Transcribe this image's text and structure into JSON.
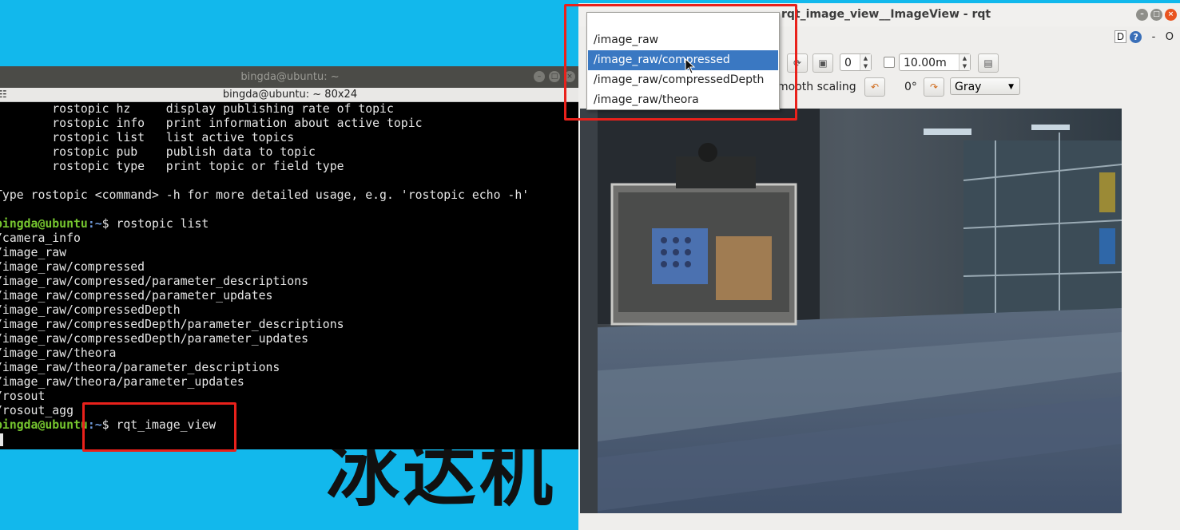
{
  "background": {
    "watermark_text": "冰达机",
    "color": "#12b8ec"
  },
  "terminal": {
    "title": "bingda@ubuntu: ~",
    "subtitle": "bingda@ubuntu: ~ 80x24",
    "lines": [
      {
        "type": "text",
        "text": "        rostopic hz     display publishing rate of topic"
      },
      {
        "type": "text",
        "text": "        rostopic info   print information about active topic"
      },
      {
        "type": "text",
        "text": "        rostopic list   list active topics"
      },
      {
        "type": "text",
        "text": "        rostopic pub    publish data to topic"
      },
      {
        "type": "text",
        "text": "        rostopic type   print topic or field type"
      },
      {
        "type": "text",
        "text": ""
      },
      {
        "type": "text",
        "text": "Type rostopic <command> -h for more detailed usage, e.g. 'rostopic echo -h'"
      },
      {
        "type": "text",
        "text": ""
      },
      {
        "type": "prompt",
        "user": "bingda@ubuntu",
        "path": ":~",
        "cmd": "$ rostopic list"
      },
      {
        "type": "text",
        "text": "/camera_info"
      },
      {
        "type": "text",
        "text": "/image_raw"
      },
      {
        "type": "text",
        "text": "/image_raw/compressed"
      },
      {
        "type": "text",
        "text": "/image_raw/compressed/parameter_descriptions"
      },
      {
        "type": "text",
        "text": "/image_raw/compressed/parameter_updates"
      },
      {
        "type": "text",
        "text": "/image_raw/compressedDepth"
      },
      {
        "type": "text",
        "text": "/image_raw/compressedDepth/parameter_descriptions"
      },
      {
        "type": "text",
        "text": "/image_raw/compressedDepth/parameter_updates"
      },
      {
        "type": "text",
        "text": "/image_raw/theora"
      },
      {
        "type": "text",
        "text": "/image_raw/theora/parameter_descriptions"
      },
      {
        "type": "text",
        "text": "/image_raw/theora/parameter_updates"
      },
      {
        "type": "text",
        "text": "/rosout"
      },
      {
        "type": "text",
        "text": "/rosout_agg"
      },
      {
        "type": "prompt",
        "user": "bingda@ubuntu",
        "path": ":~",
        "cmd": "$ rqt_image_view"
      }
    ],
    "prompt_color_user": "#76c62f",
    "prompt_color_path": "#6d97d6"
  },
  "rqt": {
    "title": "rqt_image_view__ImageView - rqt",
    "help_d": "D",
    "help_q": "?",
    "help_dash": "-",
    "help_o": "O",
    "smooth_scaling_label": "mooth scaling",
    "spin_value": "0",
    "timeout_value": "10.00m",
    "rotation_label": "0°",
    "color_scheme": "Gray",
    "topic_options": [
      "/image_raw",
      "/image_raw/compressed",
      "/image_raw/compressedDepth",
      "/image_raw/theora"
    ],
    "selected_option_index": 1
  },
  "highlight_color": "#e9211b"
}
